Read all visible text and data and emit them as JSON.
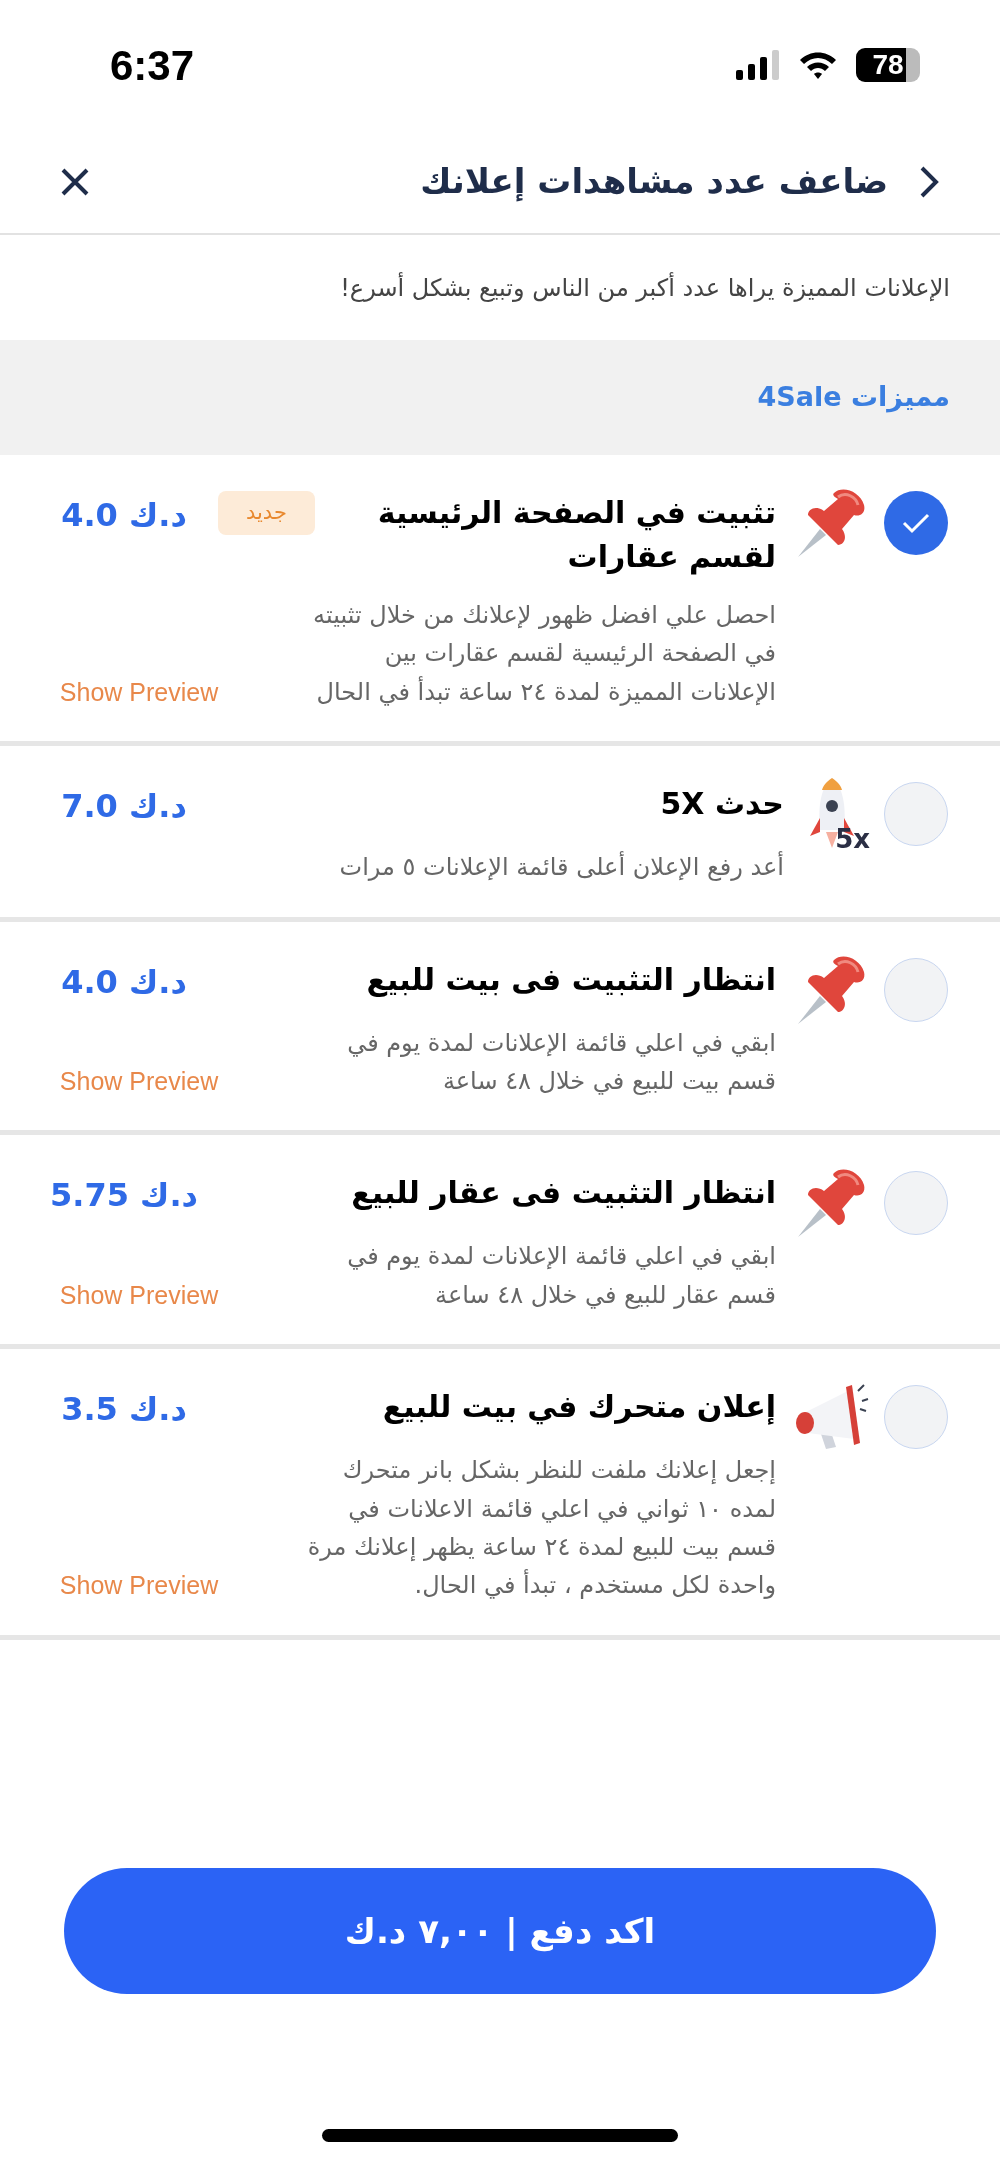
{
  "status_bar": {
    "time": "6:37",
    "battery": "78"
  },
  "header": {
    "title": "ضاعف عدد مشاهدات إعلانك"
  },
  "subtitle": "الإعلانات المميزة يراها عدد أكبر من الناس وتبيع بشكل أسرع!",
  "section_title": "مميزات 4Sale",
  "items": [
    {
      "kind": "pin",
      "selected": true,
      "title": "تثبيت في الصفحة الرئيسية لقسم عقارات",
      "badge": "جديد",
      "price": "4.0 د.ك",
      "description": "احصل علي افضل ظهور لإعلانك من خلال تثبيته في الصفحة الرئيسية لقسم عقارات بين الإعلانات المميزة لمدة ٢٤ ساعة تبدأ في الحال",
      "preview": "Show Preview"
    },
    {
      "kind": "rocket",
      "icon_text": "5x",
      "selected": false,
      "title": "حدث 5X",
      "price": "7.0 د.ك",
      "description": "أعد رفع الإعلان أعلى قائمة الإعلانات ٥ مرات"
    },
    {
      "kind": "pin",
      "selected": false,
      "title": "انتظار التثبيت فى بيت للبيع",
      "price": "4.0 د.ك",
      "description": "ابقي في اعلي قائمة الإعلانات لمدة يوم في قسم بيت للبيع في خلال ٤٨ ساعة",
      "preview": "Show Preview"
    },
    {
      "kind": "pin",
      "selected": false,
      "title": "انتظار التثبيت فى عقار للبيع",
      "price": "5.75 د.ك",
      "description": "ابقي في اعلي قائمة الإعلانات لمدة يوم في قسم عقار للبيع في خلال ٤٨ ساعة",
      "preview": "Show Preview"
    },
    {
      "kind": "megaphone",
      "selected": false,
      "title": "إعلان متحرك في بيت للبيع",
      "price": "3.5 د.ك",
      "description": "إجعل إعلانك ملفت للنظر بشكل بانر متحرك لمده ١٠ ثواني في اعلي قائمة الاعلانات في قسم بيت للبيع لمدة ٢٤ ساعة  يظهر إعلانك مرة واحدة لكل مستخدم ، تبدأ في الحال.",
      "preview": "Show Preview"
    }
  ],
  "confirm_button": "اكد دفع | ٧,٠٠ د.ك"
}
